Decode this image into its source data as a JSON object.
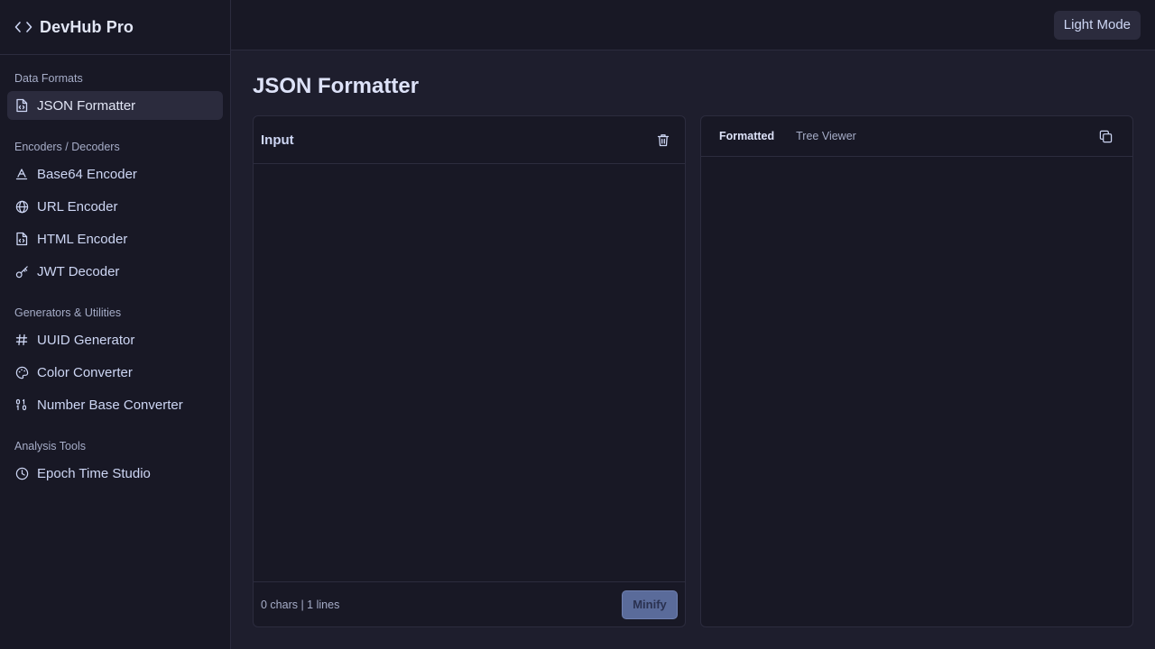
{
  "brand": {
    "name": "DevHub Pro",
    "icon": "code-brackets-icon"
  },
  "sidebar": {
    "sections": [
      {
        "title": "Data Formats",
        "items": [
          {
            "label": "JSON Formatter",
            "icon": "file-code-icon",
            "active": true
          }
        ]
      },
      {
        "title": "Encoders / Decoders",
        "items": [
          {
            "label": "Base64 Encoder",
            "icon": "letter-a-icon"
          },
          {
            "label": "URL Encoder",
            "icon": "globe-icon"
          },
          {
            "label": "HTML Encoder",
            "icon": "file-code-icon"
          },
          {
            "label": "JWT Decoder",
            "icon": "key-icon"
          }
        ]
      },
      {
        "title": "Generators & Utilities",
        "items": [
          {
            "label": "UUID Generator",
            "icon": "hash-icon"
          },
          {
            "label": "Color Converter",
            "icon": "palette-icon"
          },
          {
            "label": "Number Base Converter",
            "icon": "binary-icon"
          }
        ]
      },
      {
        "title": "Analysis Tools",
        "items": [
          {
            "label": "Epoch Time Studio",
            "icon": "clock-icon"
          }
        ]
      }
    ]
  },
  "topbar": {
    "mode_label": "Light Mode"
  },
  "page": {
    "title": "JSON Formatter"
  },
  "input_panel": {
    "title": "Input",
    "value": "",
    "stats": "0 chars | 1 lines",
    "minify_label": "Minify"
  },
  "output_panel": {
    "tabs": [
      {
        "label": "Formatted",
        "active": true
      },
      {
        "label": "Tree Viewer",
        "active": false
      }
    ]
  },
  "colors": {
    "background": "#1e1e2d",
    "sidebar": "#181825",
    "border": "#2c2c3e",
    "active_item": "#2b2b3d",
    "accent_button": "#5a6b9a"
  }
}
